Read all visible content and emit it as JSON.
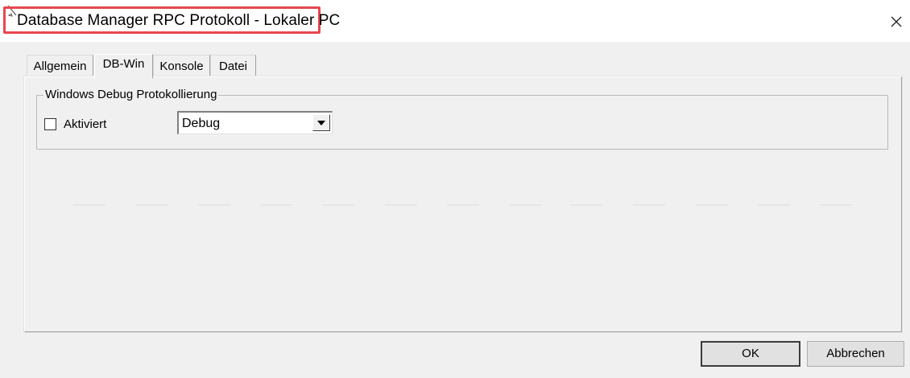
{
  "window": {
    "title": "Database Manager RPC Protokoll - Lokaler PC",
    "close_icon": "close-icon",
    "app_icon": "pen-cursor-icon",
    "highlight_color": "#e8474f"
  },
  "tabs": [
    {
      "label": "Allgemein",
      "active": false
    },
    {
      "label": "DB-Win",
      "active": true
    },
    {
      "label": "Konsole",
      "active": false
    },
    {
      "label": "Datei",
      "active": false
    }
  ],
  "group": {
    "legend": "Windows Debug Protokollierung",
    "checkbox_label": "Aktiviert",
    "checkbox_checked": false,
    "select_value": "Debug"
  },
  "buttons": {
    "ok": "OK",
    "cancel": "Abbrechen"
  }
}
